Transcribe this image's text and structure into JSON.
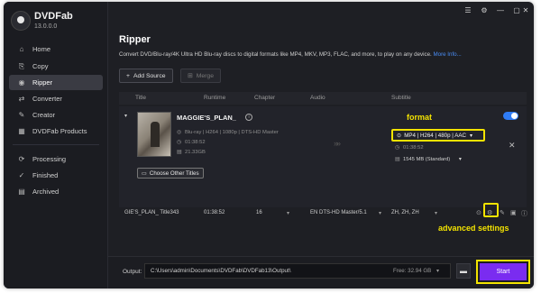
{
  "app": {
    "name": "DVDFab",
    "version": "13.0.0.0"
  },
  "window_controls": [
    {
      "name": "menu-icon",
      "glyph": "☰"
    },
    {
      "name": "settings-icon",
      "glyph": "⚙"
    },
    {
      "name": "minimize-icon",
      "glyph": "—"
    },
    {
      "name": "restore-icon",
      "glyph": "▢"
    },
    {
      "name": "close-icon",
      "glyph": "✕"
    }
  ],
  "sidebar": {
    "items": [
      {
        "label": "Home",
        "icon": "⌂",
        "name": "home"
      },
      {
        "label": "Copy",
        "icon": "⎘",
        "name": "copy"
      },
      {
        "label": "Ripper",
        "icon": "◉",
        "name": "ripper",
        "active": true
      },
      {
        "label": "Converter",
        "icon": "⇄",
        "name": "converter"
      },
      {
        "label": "Creator",
        "icon": "✎",
        "name": "creator"
      },
      {
        "label": "DVDFab Products",
        "icon": "▦",
        "name": "products"
      }
    ],
    "status_items": [
      {
        "label": "Processing",
        "icon": "⟳",
        "name": "processing"
      },
      {
        "label": "Finished",
        "icon": "✓",
        "name": "finished"
      },
      {
        "label": "Archived",
        "icon": "▤",
        "name": "archived"
      }
    ]
  },
  "main": {
    "title": "Ripper",
    "description": "Convert DVD/Blu-ray/4K Ultra HD Blu-ray discs to digital formats like MP4, MKV, MP3, FLAC, and more, to play on any device.",
    "more_info": "More Info...",
    "add_source": "Add Source",
    "merge": "Merge",
    "columns": [
      "Title",
      "Runtime",
      "Chapter",
      "Audio",
      "Subtitle"
    ]
  },
  "movie": {
    "title": "MAGGIE'S_PLAN_",
    "source_info": "Blu-ray | H264 | 1080p | DTS-HD Master",
    "runtime": "01:38:52",
    "size": "21.33GB",
    "format": "MP4 | H264 | 480p | AAC",
    "out_runtime": "01:38:52",
    "out_size": "1545 MB (Standard)",
    "choose_titles": "Choose Other Titles",
    "enabled": true
  },
  "track": {
    "title": "GIE'S_PLAN_ Title343",
    "runtime": "01:38:52",
    "chapter": "16",
    "audio": "EN  DTS-HD Master/5.1",
    "subtitle": "ZH, ZH, ZH"
  },
  "annotations": {
    "format": "format",
    "advanced": "advanced settings"
  },
  "bottom": {
    "output_label": "Output:",
    "output_path": "C:\\Users\\admin\\Documents\\DVDFab\\DVDFab13\\Output\\",
    "free_space": "Free: 32.94 GB",
    "start": "Start"
  },
  "colors": {
    "accent": "#7a2cf0",
    "highlight": "#f3e300",
    "toggle": "#2f7cf6"
  }
}
